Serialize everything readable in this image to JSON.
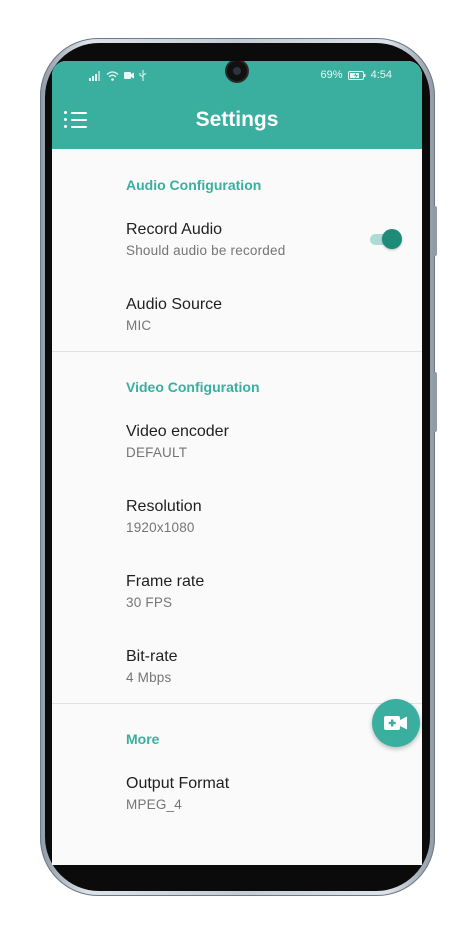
{
  "status_bar": {
    "battery": "69%",
    "time": "4:54"
  },
  "app_bar": {
    "title": "Settings",
    "menu_icon": "menu-icon"
  },
  "sections": {
    "audio": {
      "header": "Audio Configuration",
      "record_audio": {
        "title": "Record Audio",
        "summary": "Should audio be recorded",
        "enabled": true
      },
      "audio_source": {
        "title": "Audio Source",
        "summary": "MIC"
      }
    },
    "video": {
      "header": "Video Configuration",
      "encoder": {
        "title": "Video encoder",
        "summary": "DEFAULT"
      },
      "resolution": {
        "title": "Resolution",
        "summary": "1920x1080"
      },
      "frame_rate": {
        "title": "Frame rate",
        "summary": "30 FPS"
      },
      "bit_rate": {
        "title": "Bit-rate",
        "summary": "4 Mbps"
      }
    },
    "more": {
      "header": "More",
      "output_format": {
        "title": "Output Format",
        "summary": "MPEG_4"
      }
    }
  },
  "fab": {
    "icon": "video-camera-add-icon"
  },
  "colors": {
    "accent": "#3aaf9f",
    "toggle_thumb": "#1e8b78",
    "background": "#fafafa",
    "title_text": "#1f1f1f",
    "summary_text": "#757575"
  }
}
